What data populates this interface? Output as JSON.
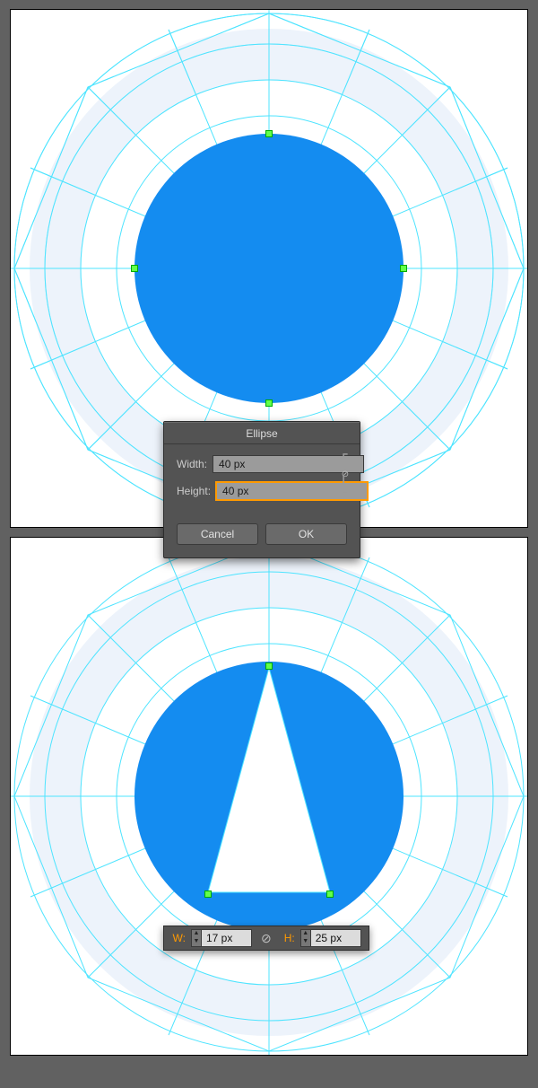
{
  "dialog": {
    "title": "Ellipse",
    "width_label": "Width:",
    "width_value": "40 px",
    "height_label": "Height:",
    "height_value": "40 px",
    "cancel": "Cancel",
    "ok": "OK"
  },
  "transform_bar": {
    "w_label": "W:",
    "w_value": "17 px",
    "h_label": "H:",
    "h_value": "25 px"
  },
  "colors": {
    "guide": "#00e6ff",
    "guide_fill": "#dfeaf8",
    "shape": "#148cf0",
    "anchor": "#62ff4a",
    "accent": "#ff9a00"
  },
  "artboards": {
    "top": {
      "shape": "circle"
    },
    "bottom": {
      "shape": "circle_with_triangle"
    }
  }
}
